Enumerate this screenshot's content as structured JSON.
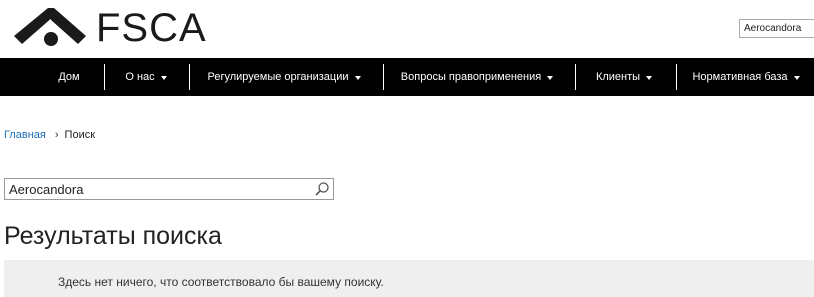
{
  "header": {
    "logo_text": "FSCA",
    "search_value": "Aerocandora"
  },
  "nav": {
    "items": [
      {
        "label": "Дом",
        "has_dropdown": false
      },
      {
        "label": "О нас",
        "has_dropdown": true
      },
      {
        "label": "Регулируемые организации",
        "has_dropdown": true
      },
      {
        "label": "Вопросы правоприменения",
        "has_dropdown": true
      },
      {
        "label": "Клиенты",
        "has_dropdown": true
      },
      {
        "label": "Нормативная база",
        "has_dropdown": true
      }
    ]
  },
  "breadcrumb": {
    "home": "Главная",
    "separator": "›",
    "current": "Поиск"
  },
  "search": {
    "value": "Aerocandora"
  },
  "results": {
    "title": "Результаты поиска",
    "message": "Здесь нет ничего, что соответствовало бы вашему поиску."
  },
  "colors": {
    "nav_bg": "#000000",
    "link": "#1e6fb9",
    "panel_bg": "#efefef"
  }
}
